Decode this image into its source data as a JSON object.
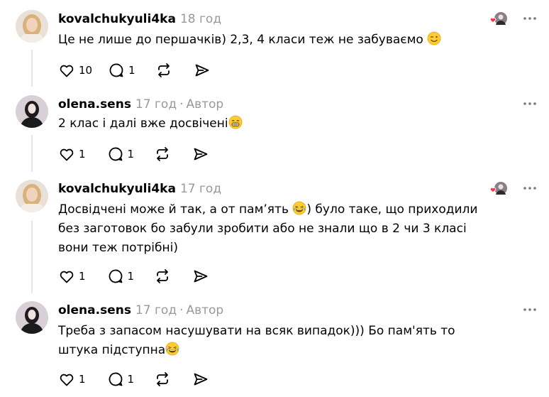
{
  "comments": [
    {
      "username": "kovalchukyuli4ka",
      "time": "18 год",
      "author_label": "",
      "text": "Це не лише до першачків) 2,3, 4 класи теж не забуваємо",
      "likes": "10",
      "replies": "1",
      "liked_by_author": true
    },
    {
      "username": "olena.sens",
      "time": "17 год",
      "author_label": "Автор",
      "text": "2 клас і далі вже досвічені",
      "likes": "1",
      "replies": "1",
      "liked_by_author": false
    },
    {
      "username": "kovalchukyuli4ka",
      "time": "17 год",
      "author_label": "",
      "text_part1": "Досвідчені може й так, а от пам’ять ",
      "text_part2": ") було таке, що приходили без заготовок бо забули зробити або не знали що в 2 чи 3 класі вони теж потрібні)",
      "likes": "1",
      "replies": "1",
      "liked_by_author": true
    },
    {
      "username": "olena.sens",
      "time": "17 год",
      "author_label": "Автор",
      "text": "Треба з запасом насушувати на всяк випадок))) Бо пам'ять то штука підступна",
      "likes": "1",
      "replies": "1",
      "liked_by_author": false
    }
  ],
  "colors": {
    "heart_red": "#ff3040",
    "muted": "#999999",
    "line": "#e6e6e6"
  }
}
